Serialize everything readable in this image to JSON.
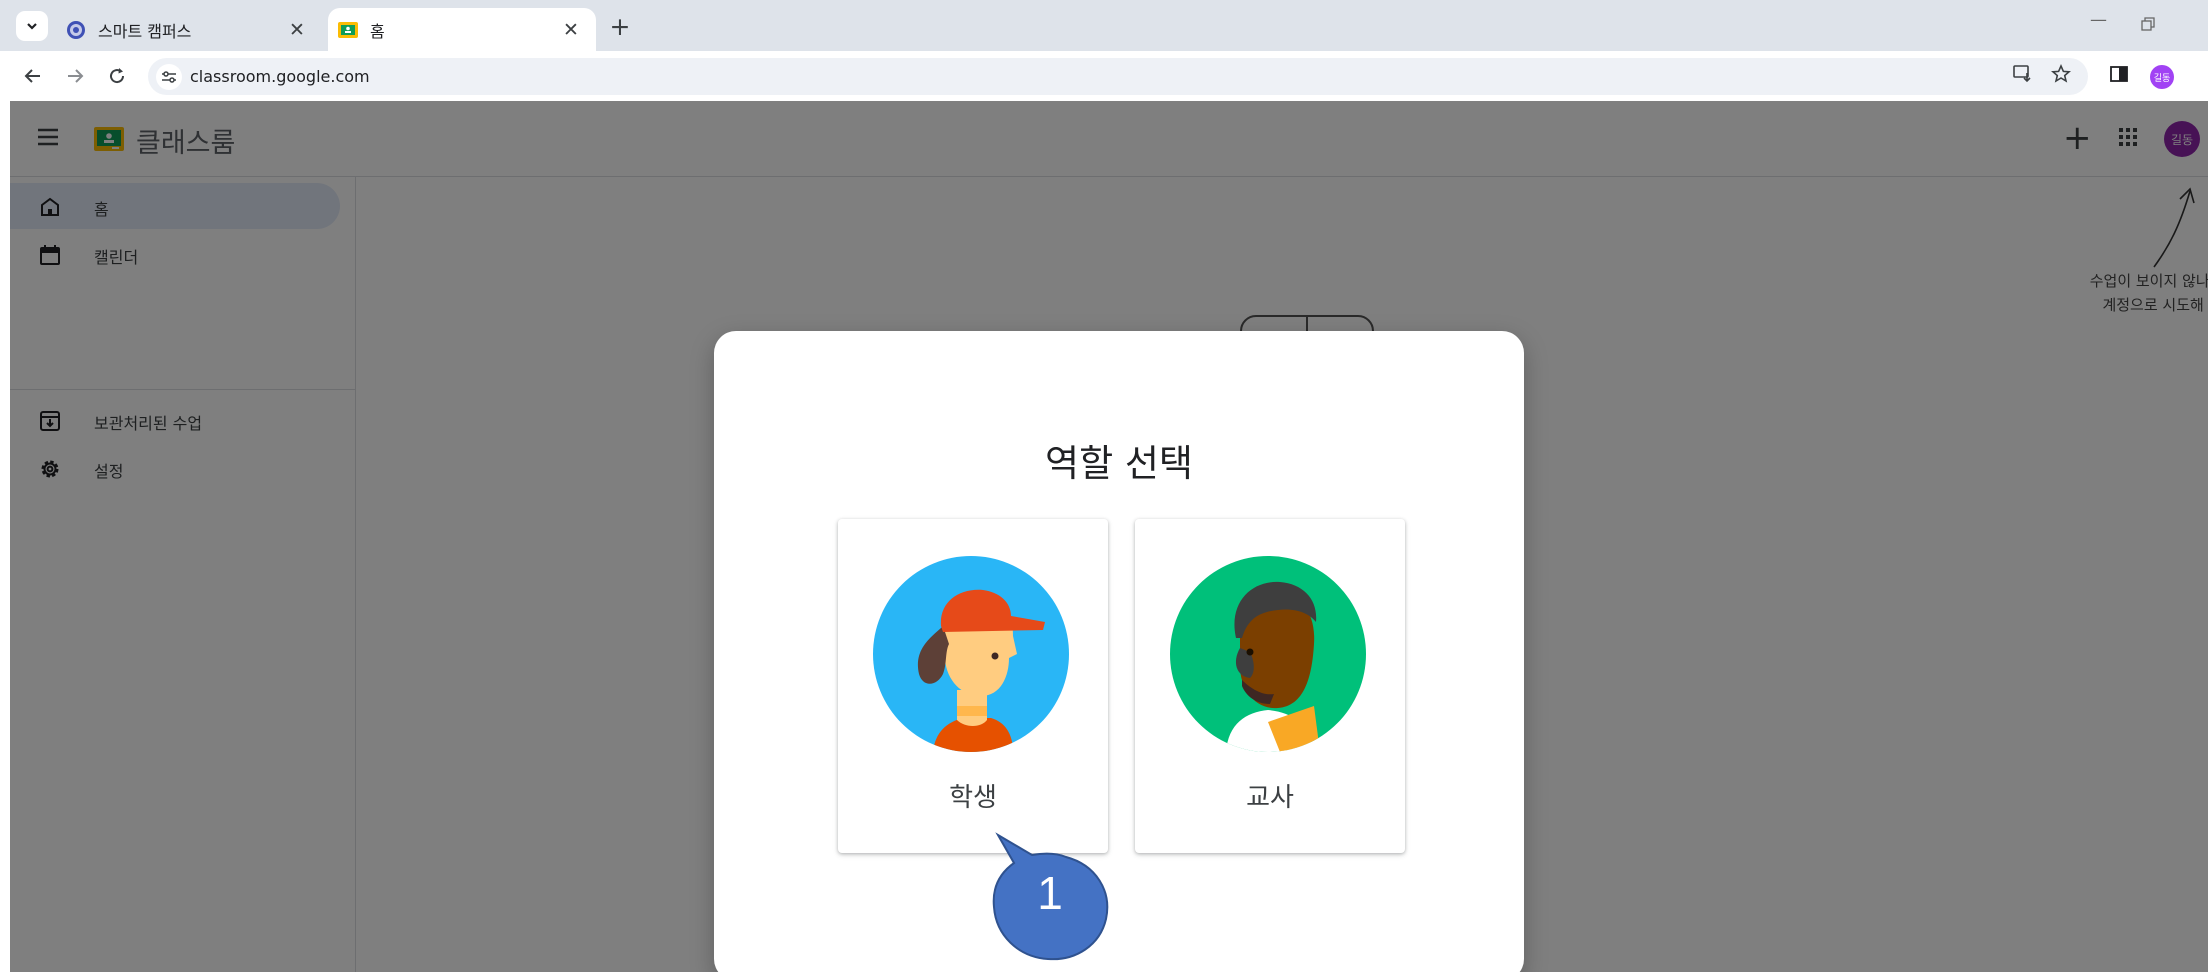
{
  "browser": {
    "tabs": [
      {
        "title": "스마트 캠퍼스",
        "active": false
      },
      {
        "title": "홈",
        "active": true
      }
    ],
    "url": "classroom.google.com",
    "colors": {
      "tabstrip": "#dee3ea",
      "omnibox": "#eef1f6"
    }
  },
  "app": {
    "title": "클래스룸",
    "account_initials": "길동",
    "colors": {
      "brand": "#0f9d58",
      "account": "#8e24aa"
    }
  },
  "sidebar": {
    "items": [
      {
        "label": "홈",
        "icon": "home-icon",
        "active": true
      },
      {
        "label": "캘린더",
        "icon": "calendar-icon",
        "active": false
      },
      {
        "label": "보관처리된 수업",
        "icon": "archive-icon",
        "active": false
      },
      {
        "label": "설정",
        "icon": "settings-icon",
        "active": false
      }
    ]
  },
  "hint": {
    "text": "수업이 보이지 않나요? 다\n계정으로 시도해 보세요"
  },
  "dialog": {
    "title": "역할 선택",
    "roles": [
      {
        "label": "학생",
        "avatar": "student-avatar"
      },
      {
        "label": "교사",
        "avatar": "teacher-avatar"
      }
    ]
  },
  "annotation": {
    "callout_number": "1",
    "color": "#4472c4"
  }
}
